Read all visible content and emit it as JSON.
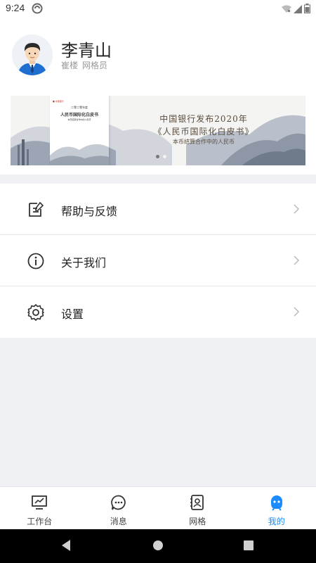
{
  "status": {
    "time": "9:24"
  },
  "user": {
    "name": "李青山",
    "location": "崔楼",
    "role": "网格员"
  },
  "banner": {
    "line1": "中国银行发布2020年",
    "line2": "《人民币国际化白皮书》",
    "subtitle": "本币结算合作中的人民币",
    "book": {
      "top": "二零二零年度",
      "title": "人民币国际化白皮书",
      "sub": "本币结算合作中的人民币"
    }
  },
  "menu": {
    "items": [
      {
        "label": "帮助与反馈",
        "icon": "edit-icon"
      },
      {
        "label": "关于我们",
        "icon": "info-icon"
      },
      {
        "label": "设置",
        "icon": "gear-icon"
      }
    ]
  },
  "tabs": [
    {
      "label": "工作台",
      "icon": "monitor-icon"
    },
    {
      "label": "消息",
      "icon": "message-icon"
    },
    {
      "label": "网格",
      "icon": "contacts-icon"
    },
    {
      "label": "我的",
      "icon": "profile-icon",
      "active": true
    }
  ],
  "colors": {
    "accent": "#1a8cff",
    "background": "#f0f1f5"
  }
}
